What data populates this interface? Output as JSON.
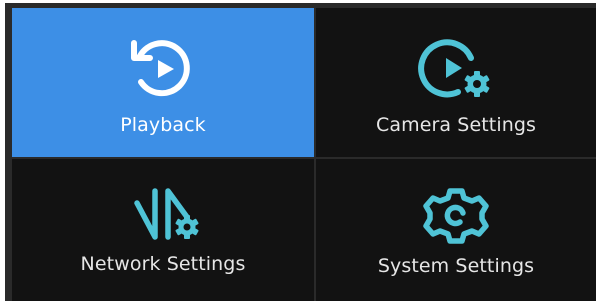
{
  "menu": {
    "items": [
      {
        "label": "Playback",
        "icon": "playback-icon",
        "selected": true
      },
      {
        "label": "Camera Settings",
        "icon": "camera-settings-icon",
        "selected": false
      },
      {
        "label": "Network Settings",
        "icon": "network-settings-icon",
        "selected": false
      },
      {
        "label": "System Settings",
        "icon": "system-settings-icon",
        "selected": false
      }
    ]
  },
  "colors": {
    "selected_background": "#3d8fe6",
    "tile_background": "#121212",
    "divider": "#2a2a2a",
    "icon_color": "#4fc3d6",
    "selected_icon_color": "#ffffff",
    "label_color": "#e6e6e6"
  }
}
